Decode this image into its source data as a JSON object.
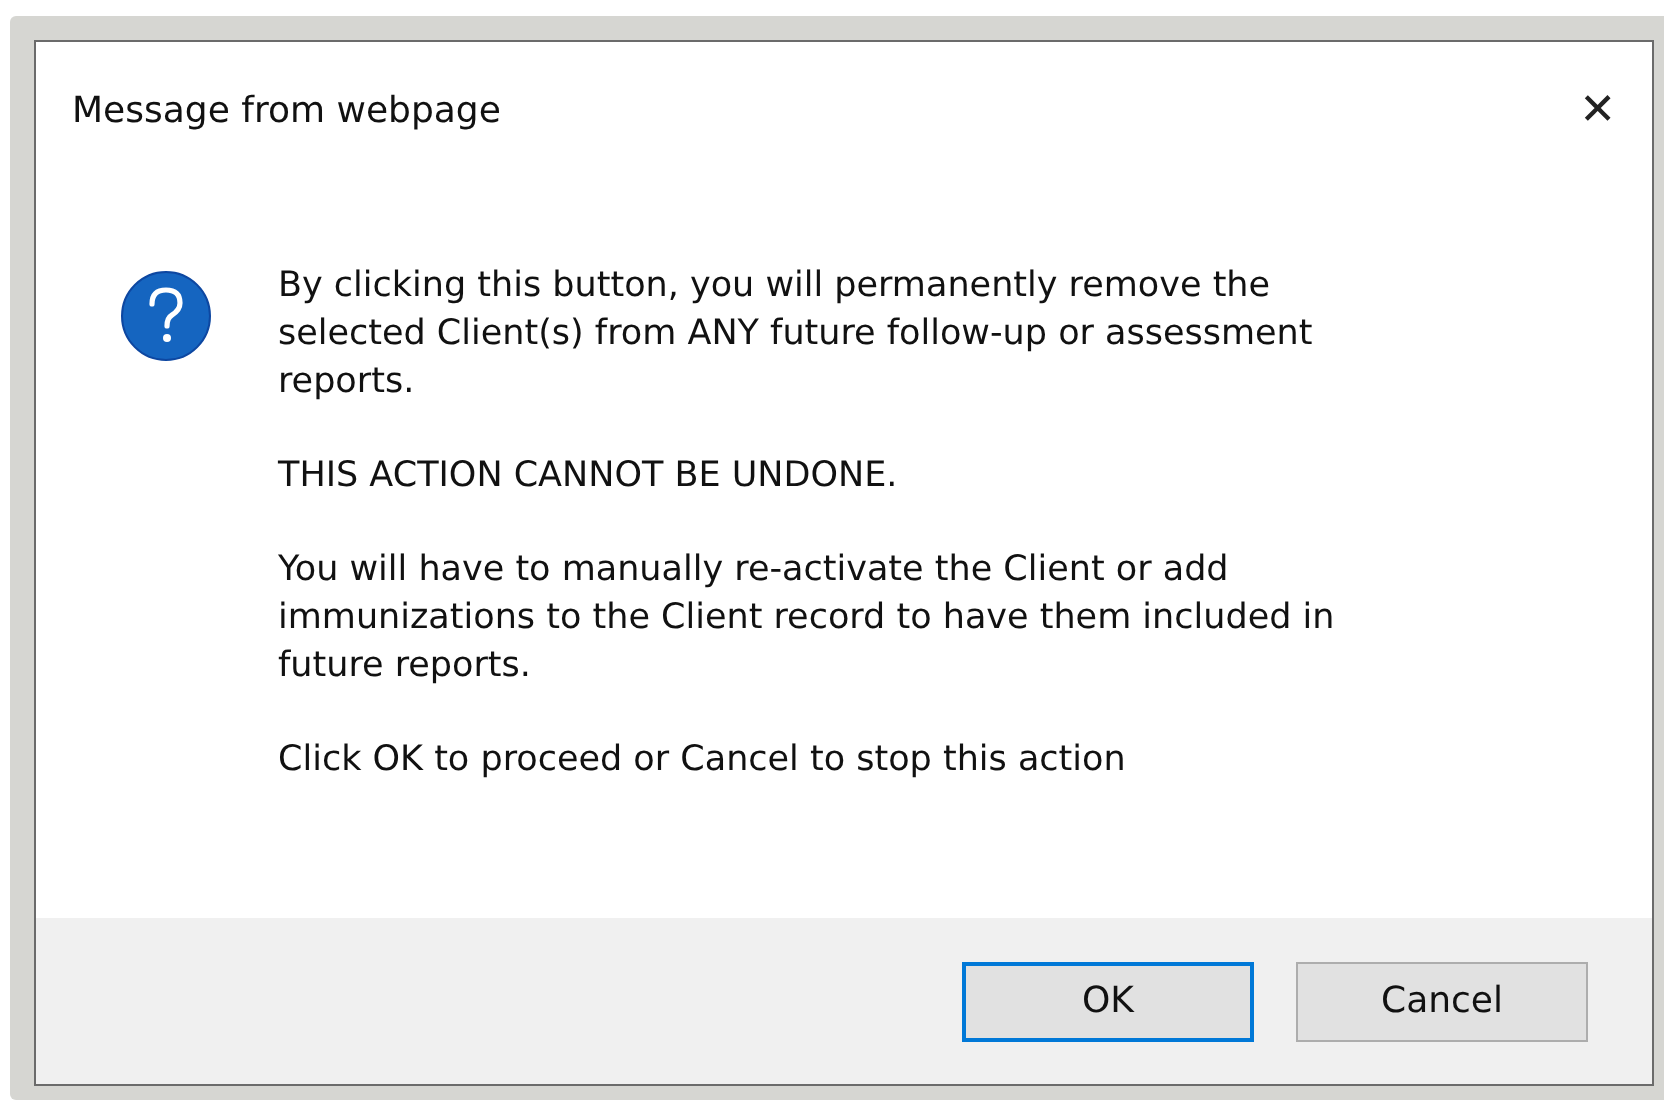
{
  "dialog": {
    "title": "Message from webpage",
    "close": "✕",
    "paragraphs": [
      "By clicking this button, you will permanently remove the selected Client(s) from ANY future follow-up or assessment reports.",
      "THIS ACTION CANNOT BE UNDONE.",
      "You will have to manually re-activate the Client or add immunizations to the Client record to have them included in future reports.",
      "Click OK to proceed or Cancel to stop this action"
    ],
    "buttons": [
      {
        "label": "OK",
        "default": true
      },
      {
        "label": "Cancel",
        "default": false
      }
    ]
  }
}
